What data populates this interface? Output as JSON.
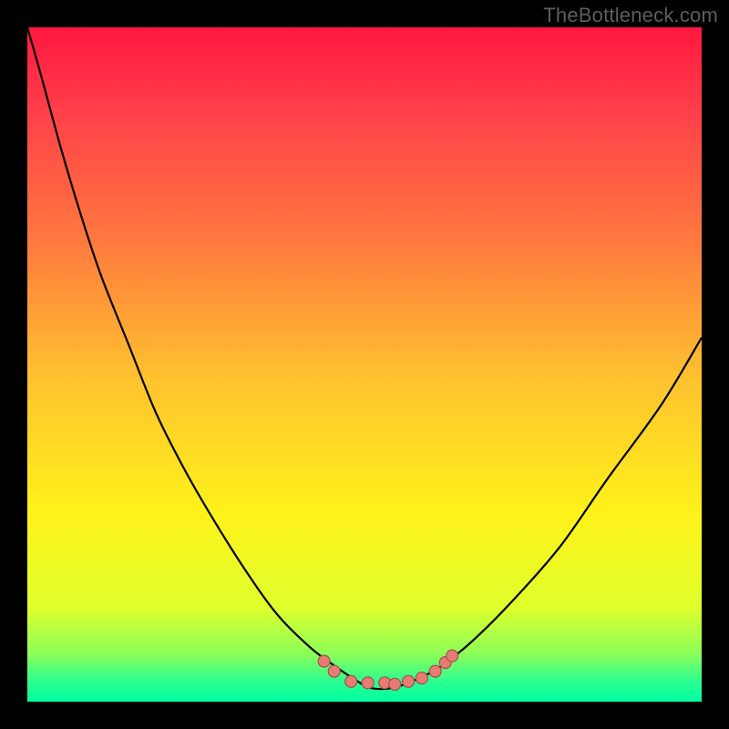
{
  "watermark": {
    "text": "TheBottleneck.com"
  },
  "chart_data": {
    "type": "line",
    "title": "",
    "xlabel": "",
    "ylabel": "",
    "xlim": [
      0,
      100
    ],
    "ylim": [
      0,
      100
    ],
    "background_gradient_stops": [
      {
        "pos": 0.0,
        "color": "#ff173f"
      },
      {
        "pos": 0.12,
        "color": "#ff3e4a"
      },
      {
        "pos": 0.32,
        "color": "#ff7a3e"
      },
      {
        "pos": 0.52,
        "color": "#ffc22f"
      },
      {
        "pos": 0.72,
        "color": "#fff21a"
      },
      {
        "pos": 0.86,
        "color": "#dfff2b"
      },
      {
        "pos": 0.93,
        "color": "#8bff5a"
      },
      {
        "pos": 0.97,
        "color": "#2bff91"
      },
      {
        "pos": 1.0,
        "color": "#02ffa2"
      }
    ],
    "series": [
      {
        "name": "bottleneck-curve",
        "stroke": "#000000",
        "x": [
          0,
          2,
          5,
          8,
          11,
          15,
          19,
          23,
          27,
          32,
          37,
          42,
          46,
          49,
          51,
          54,
          57,
          61,
          66,
          72,
          79,
          86,
          94,
          100
        ],
        "y": [
          100,
          93,
          82,
          72,
          63,
          53,
          43,
          35,
          28,
          20,
          13,
          8,
          5,
          3,
          2,
          2,
          3,
          5,
          9,
          15,
          23,
          33,
          44,
          54
        ]
      }
    ],
    "markers": {
      "name": "highlight-dots",
      "color": "#e67c73",
      "stroke": "#a64f47",
      "points": [
        {
          "x": 44.0,
          "y": 6.0
        },
        {
          "x": 45.5,
          "y": 4.5
        },
        {
          "x": 48.0,
          "y": 3.0
        },
        {
          "x": 50.5,
          "y": 2.8
        },
        {
          "x": 53.0,
          "y": 2.8
        },
        {
          "x": 54.5,
          "y": 2.6
        },
        {
          "x": 56.5,
          "y": 3.0
        },
        {
          "x": 58.5,
          "y": 3.5
        },
        {
          "x": 60.5,
          "y": 4.5
        },
        {
          "x": 62.0,
          "y": 5.8
        },
        {
          "x": 63.0,
          "y": 6.8
        }
      ]
    }
  }
}
